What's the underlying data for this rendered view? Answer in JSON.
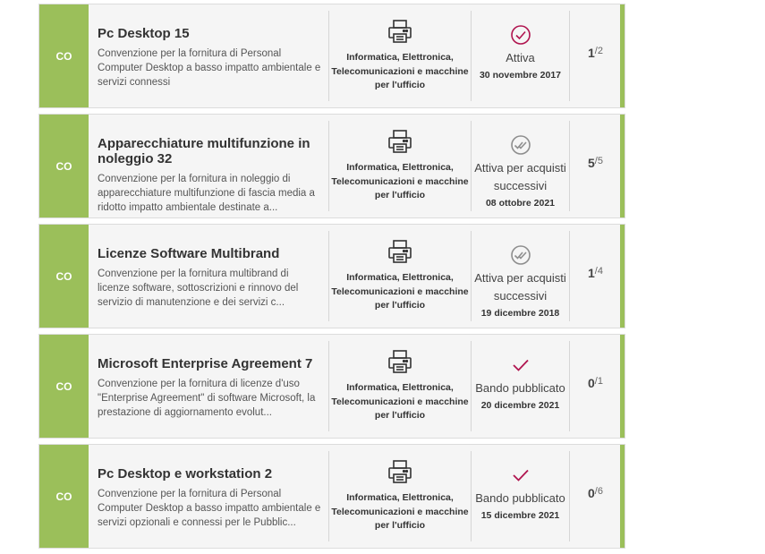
{
  "colors": {
    "accent": "#9bbf5a",
    "active": "#b0144f",
    "inactive": "#8e8e8e"
  },
  "cards": [
    {
      "badge": "CO",
      "title": "Pc Desktop 15",
      "description": "Convenzione per la fornitura di Personal Computer Desktop a basso impatto ambientale e servizi connessi",
      "category": "Informatica, Elettronica, Telecomunicazioni e macchine per l'ufficio",
      "status_icon": "check-circle-icon",
      "status": "Attiva",
      "date": "30 novembre 2017",
      "count": "1",
      "total": "/2"
    },
    {
      "badge": "CO",
      "title": "Apparecchiature multifunzione in noleggio 32",
      "description": "Convenzione per la fornitura in noleggio di apparecchiature multifunzione di fascia media a ridotto impatto ambientale destinate a...",
      "category": "Informatica, Elettronica, Telecomunicazioni e macchine per l'ufficio",
      "status_icon": "double-check-circle-icon",
      "status": "Attiva per acquisti successivi",
      "date": "08 ottobre 2021",
      "count": "5",
      "total": "/5"
    },
    {
      "badge": "CO",
      "title": "Licenze Software Multibrand",
      "description": "Convenzione per la fornitura multibrand di licenze software, sottoscrizioni e rinnovo del servizio di manutenzione e dei servizi c...",
      "category": "Informatica, Elettronica, Telecomunicazioni e macchine per l'ufficio",
      "status_icon": "double-check-circle-icon",
      "status": "Attiva per acquisti successivi",
      "date": "19 dicembre 2018",
      "count": "1",
      "total": "/4"
    },
    {
      "badge": "CO",
      "title": "Microsoft Enterprise Agreement 7",
      "description": "Convenzione per la fornitura di licenze d'uso \"Enterprise Agreement\" di software Microsoft, la prestazione di aggiornamento evolut...",
      "category": "Informatica, Elettronica, Telecomunicazioni e macchine per l'ufficio",
      "status_icon": "checkmark-icon",
      "status": "Bando pubblicato",
      "date": "20 dicembre 2021",
      "count": "0",
      "total": "/1"
    },
    {
      "badge": "CO",
      "title": "Pc Desktop e workstation 2",
      "description": "Convenzione per la fornitura di Personal Computer Desktop a basso impatto ambientale e servizi opzionali e connessi per le Pubblic...",
      "category": "Informatica, Elettronica, Telecomunicazioni e macchine per l'ufficio",
      "status_icon": "checkmark-icon",
      "status": "Bando pubblicato",
      "date": "15 dicembre 2021",
      "count": "0",
      "total": "/6"
    }
  ]
}
